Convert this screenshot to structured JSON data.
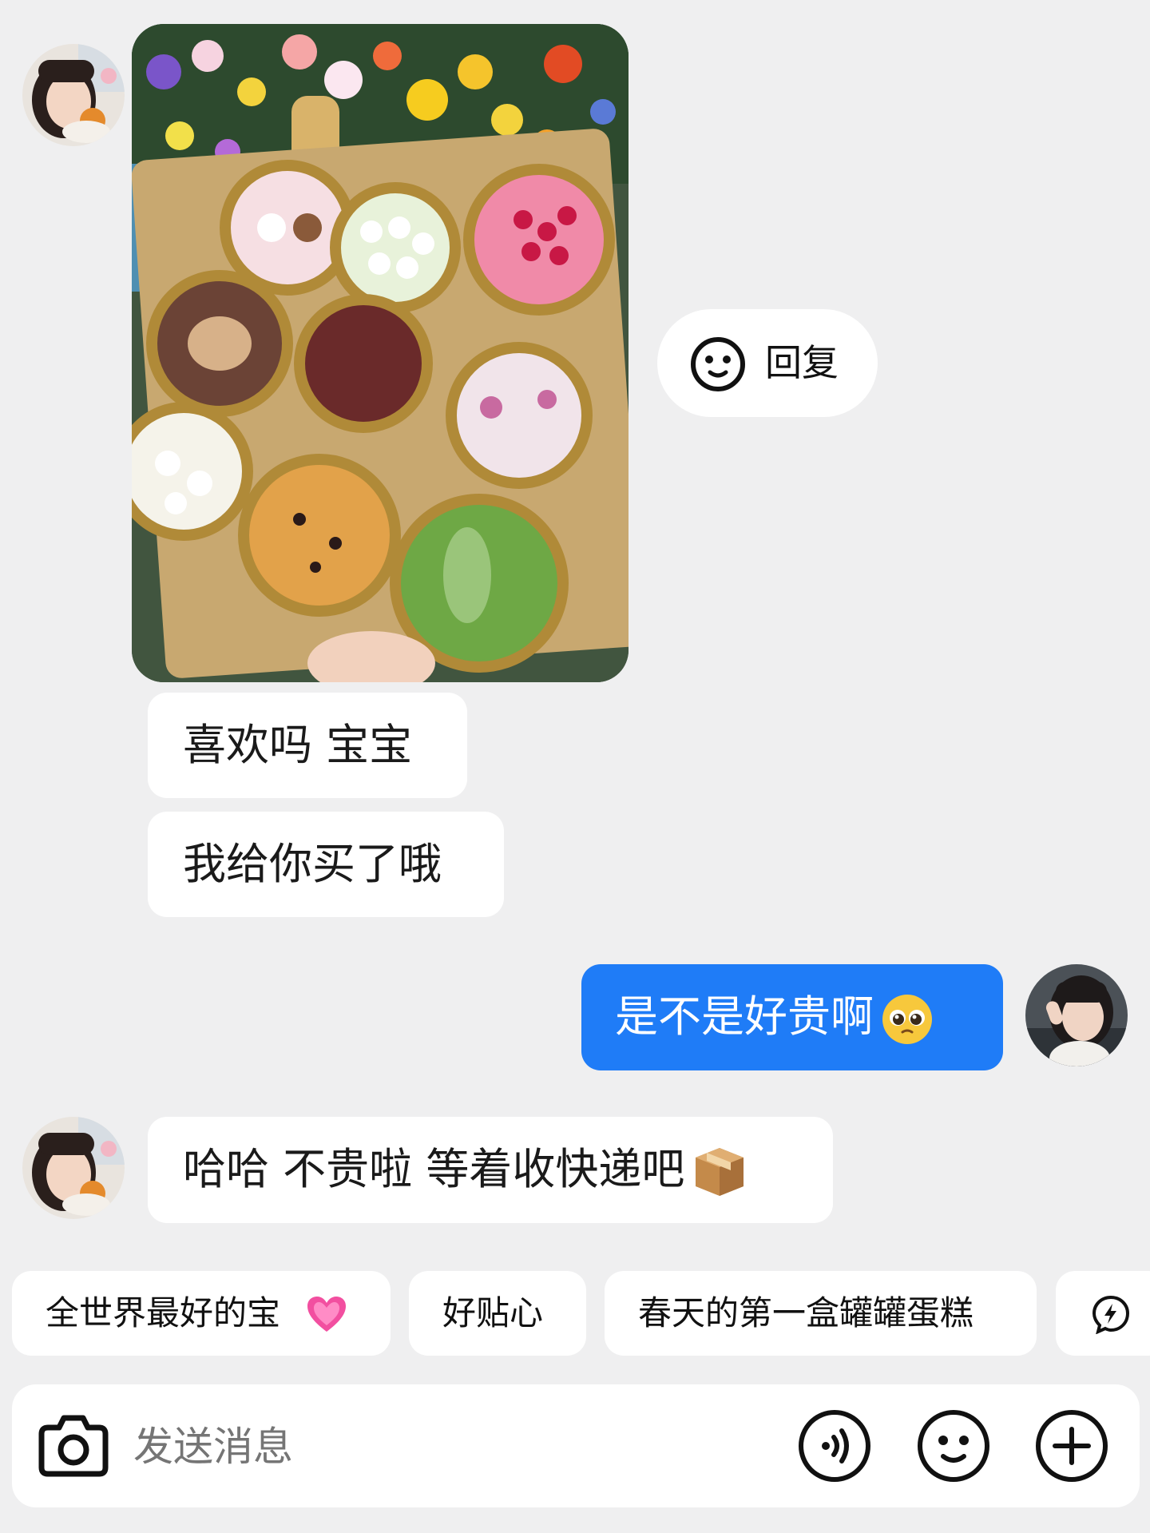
{
  "chat": {
    "reply_label": "回复",
    "messages": [
      {
        "sender": "them",
        "text": "喜欢吗 宝宝"
      },
      {
        "sender": "them",
        "text": "我给你买了哦"
      },
      {
        "sender": "me",
        "text": "是不是好贵啊"
      },
      {
        "sender": "them",
        "text": "哈哈 不贵啦 等着收快递吧"
      }
    ]
  },
  "quick_replies": [
    {
      "label": "全世界最好的宝"
    },
    {
      "label": "好贴心"
    },
    {
      "label": "春天的第一盒罐罐蛋糕"
    }
  ],
  "composer": {
    "placeholder": "发送消息"
  },
  "icons": {
    "reply": "smiley-icon",
    "camera": "camera-icon",
    "voice": "voice-icon",
    "emoji": "emoji-icon",
    "more": "plus-icon",
    "chip_extra": "lightning-bubble-icon"
  },
  "colors": {
    "background": "#efeff0",
    "my_bubble": "#1f7cf7",
    "their_bubble": "#ffffff"
  }
}
